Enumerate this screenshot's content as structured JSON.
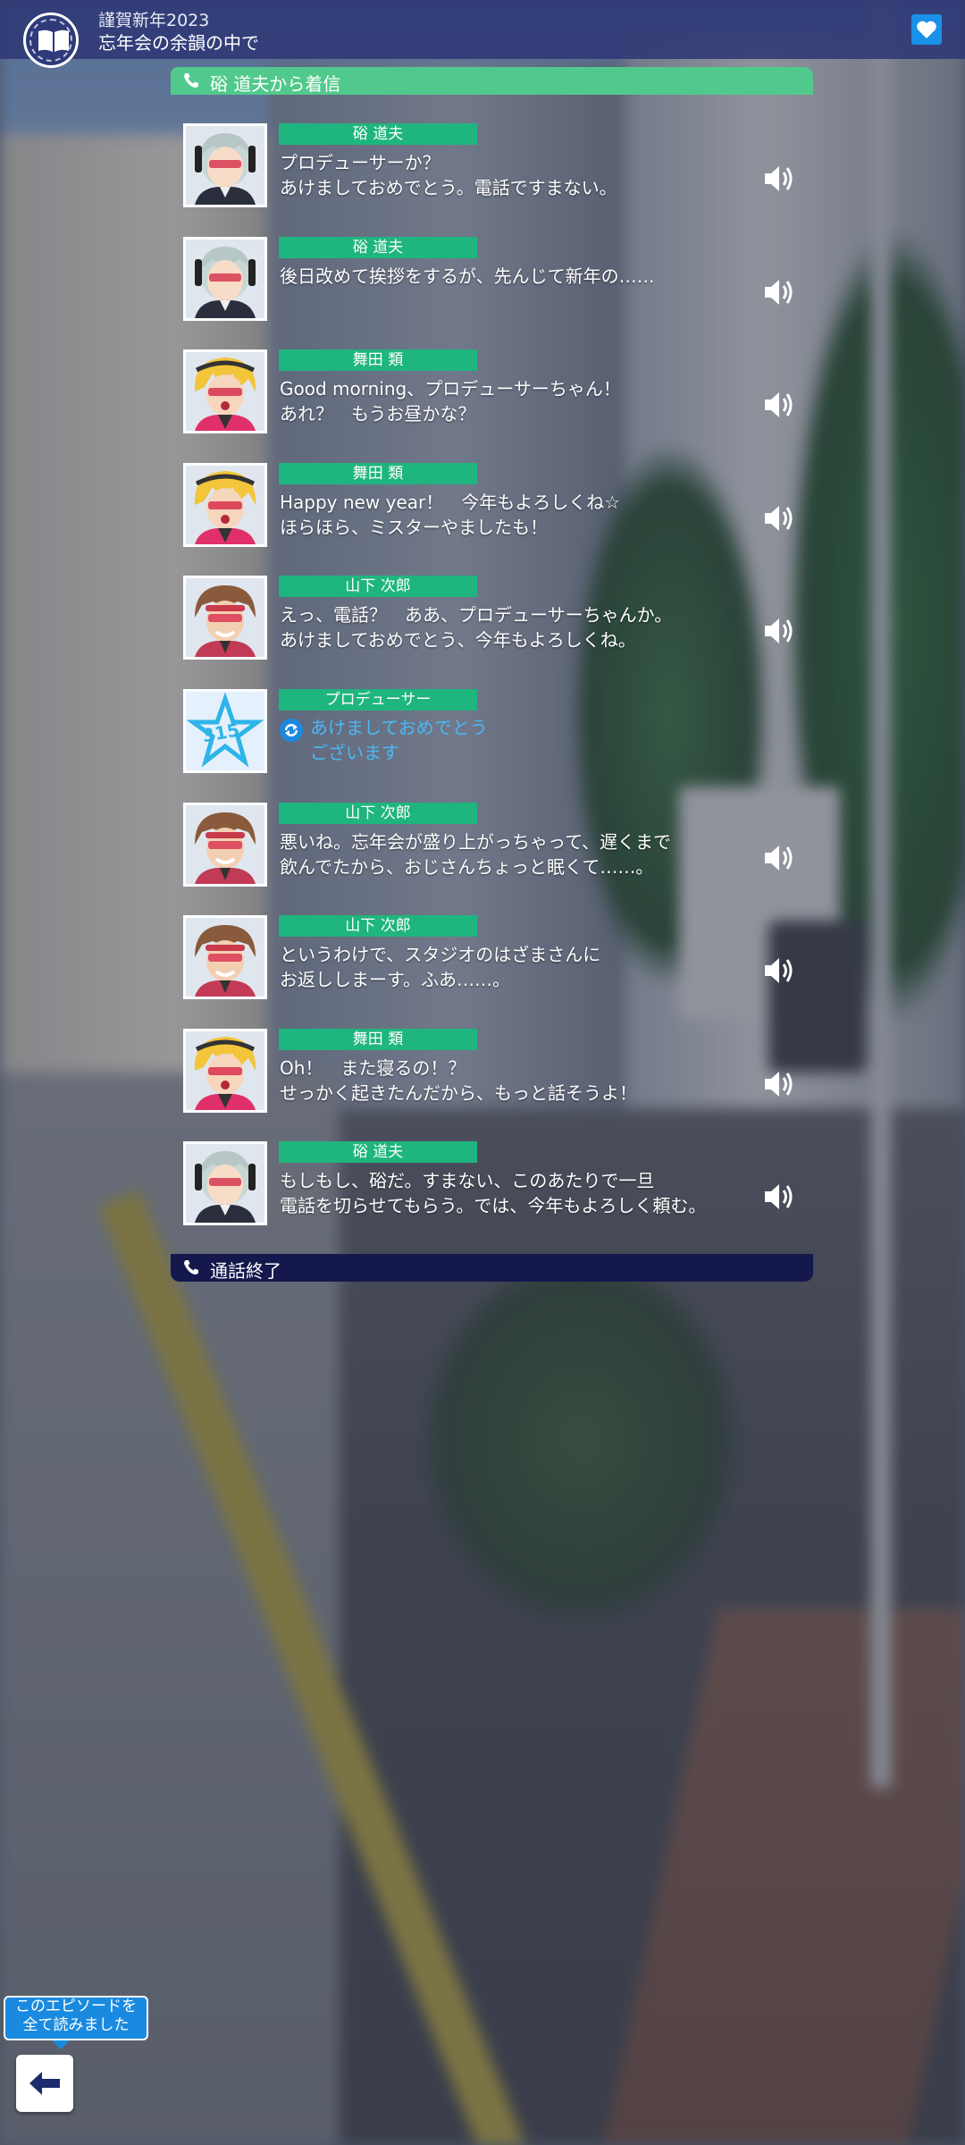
{
  "header": {
    "subtitle": "謹賀新年2023",
    "title": "忘年会の余韻の中で",
    "book_icon": "open-book-icon",
    "favorite_icon": "heart-icon"
  },
  "call": {
    "incoming_label": "硲 道夫から着信",
    "end_label": "通話終了",
    "phone_icon": "phone-icon"
  },
  "messages": [
    {
      "speaker": "硲 道夫",
      "avatar": "michio",
      "text": "プロデューサーか？\nあけましておめでとう。電話ですまない。",
      "voice_icon": "speaker-icon"
    },
    {
      "speaker": "硲 道夫",
      "avatar": "michio",
      "text": "後日改めて挨拶をするが、先んじて新年の……",
      "voice_icon": "speaker-icon"
    },
    {
      "speaker": "舞田 類",
      "avatar": "rui",
      "text": "Good morning、プロデューサーちゃん！\nあれ？　もうお昼かな？",
      "voice_icon": "speaker-icon"
    },
    {
      "speaker": "舞田 類",
      "avatar": "rui",
      "text": "Happy new year！　今年もよろしくね☆\nほらほら、ミスターやましたも！",
      "voice_icon": "speaker-icon"
    },
    {
      "speaker": "山下 次郎",
      "avatar": "jiro",
      "text": "えっ、電話？　ああ、プロデューサーちゃんか。\nあけましておめでとう、今年もよろしくね。",
      "voice_icon": "speaker-icon"
    },
    {
      "speaker": "プロデューサー",
      "avatar": "producer",
      "choice": true,
      "text": "あけましておめでとう\nございます"
    },
    {
      "speaker": "山下 次郎",
      "avatar": "jiro",
      "text": "悪いね。忘年会が盛り上がっちゃって、遅くまで\n飲んでたから、おじさんちょっと眠くて……。",
      "voice_icon": "speaker-icon"
    },
    {
      "speaker": "山下 次郎",
      "avatar": "jiro",
      "text": "というわけで、スタジオのはざまさんに\nお返ししまーす。ふあ……。",
      "voice_icon": "speaker-icon"
    },
    {
      "speaker": "舞田 類",
      "avatar": "rui",
      "text": "Oh！　また寝るの！？\nせっかく起きたんだから、もっと話そうよ！",
      "voice_icon": "speaker-icon"
    },
    {
      "speaker": "硲 道夫",
      "avatar": "michio",
      "text": "もしもし、硲だ。すまない、このあたりで一旦\n電話を切らせてもらう。では、今年もよろしく頼む。",
      "voice_icon": "speaker-icon"
    }
  ],
  "footer": {
    "read_badge": "このエピソードを\n全て読みました",
    "back_icon": "back-arrow-icon"
  },
  "colors": {
    "header_bar": "#303a76",
    "call_header": "#52c98c",
    "call_end": "#14184d",
    "name_tag": "#1fb57e",
    "choice_text": "#48b8f5",
    "accent_blue": "#1a8ae0"
  }
}
